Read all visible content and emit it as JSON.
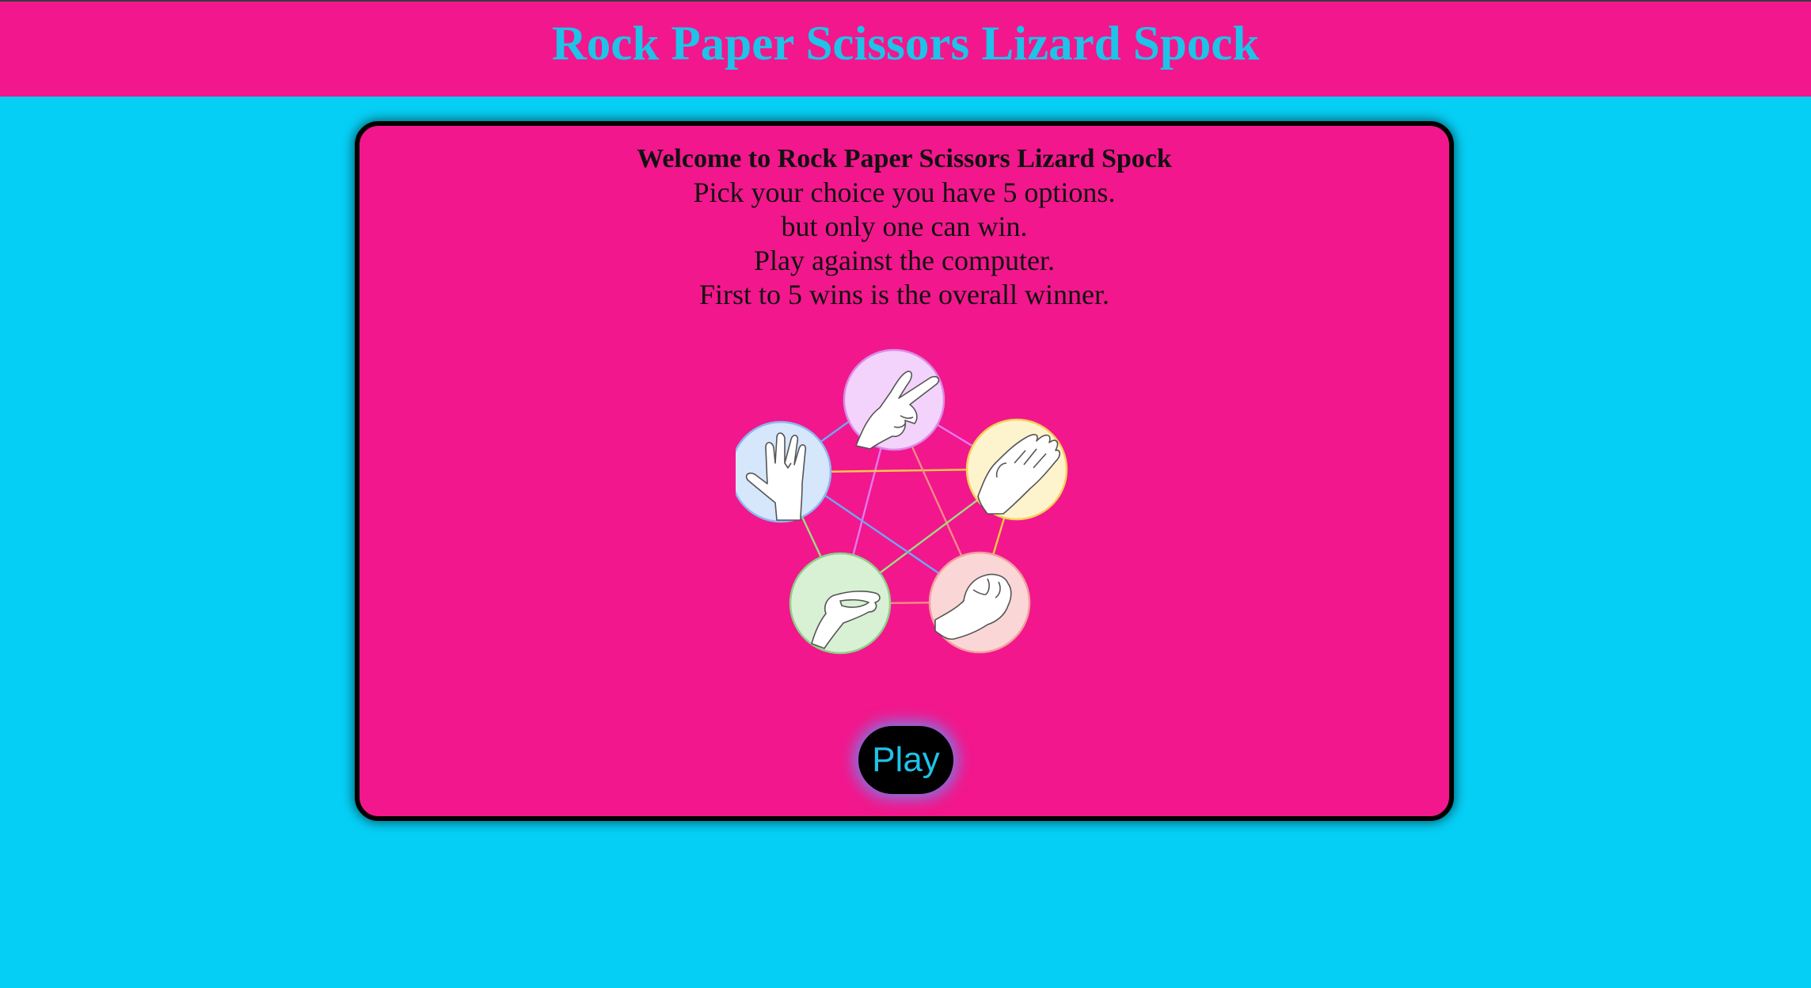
{
  "header": {
    "title": "Rock Paper Scissors Lizard Spock"
  },
  "intro": {
    "heading": "Welcome to Rock Paper Scissors Lizard Spock",
    "lines": [
      "Pick your choice you have 5 options.",
      "but only one can win.",
      "Play against the computer.",
      "First to 5 wins is the overall winner."
    ]
  },
  "diagram": {
    "choices": [
      {
        "name": "scissors",
        "icon": "scissors-hand-icon",
        "fill": "#f3d3fb",
        "stroke": "#d98be8"
      },
      {
        "name": "paper",
        "icon": "paper-hand-icon",
        "fill": "#fdf4cd",
        "stroke": "#f2d15c"
      },
      {
        "name": "rock",
        "icon": "rock-fist-icon",
        "fill": "#fbd6d6",
        "stroke": "#f0a0a0"
      },
      {
        "name": "lizard",
        "icon": "lizard-hand-icon",
        "fill": "#d8f1d4",
        "stroke": "#90d088"
      },
      {
        "name": "spock",
        "icon": "spock-hand-icon",
        "fill": "#d6e6fb",
        "stroke": "#8eb6ef"
      }
    ]
  },
  "actions": {
    "play_label": "Play"
  },
  "colors": {
    "background": "#06cff5",
    "header_bg": "#f2178c",
    "title_color": "#1ec3e8",
    "card_bg": "#f2178c",
    "button_bg": "#000000",
    "button_text": "#1ec3e8"
  }
}
